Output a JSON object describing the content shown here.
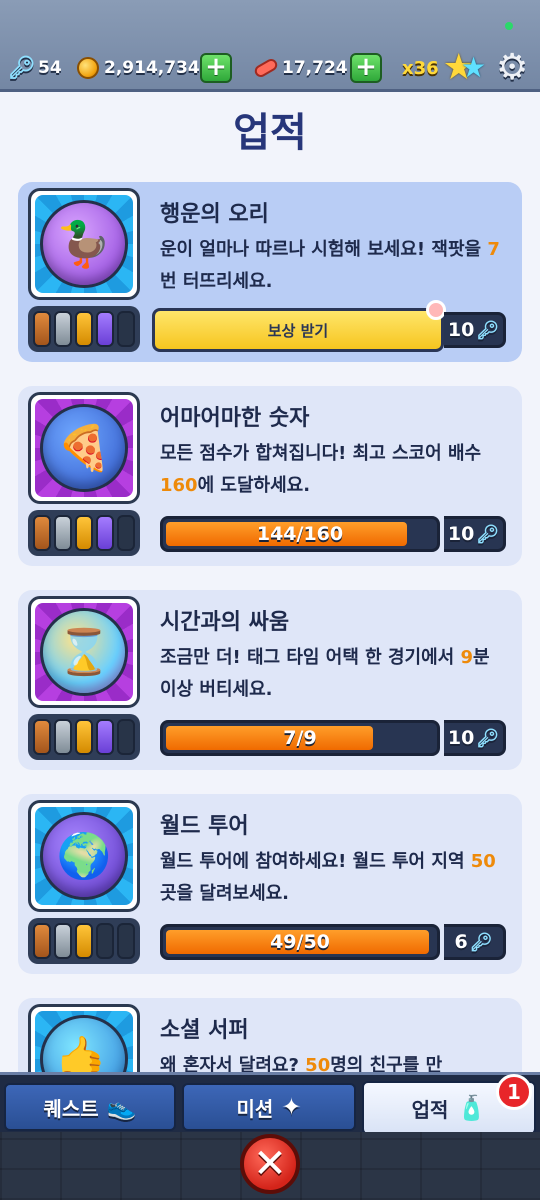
{
  "topbar": {
    "keys": "54",
    "coins": "2,914,734",
    "boards": "17,724",
    "multiplier": "x36"
  },
  "page": {
    "title": "업적"
  },
  "achievements": [
    {
      "title": "행운의 오리",
      "desc_pre": "운이 얼마나 따르나 시험해 보세요! 잭팟을 ",
      "desc_hl": "7",
      "desc_post": "번 터뜨리세요.",
      "claim_label": "보상 받기",
      "reward": "10",
      "icon": "duck-icon"
    },
    {
      "title": "어마어마한 숫자",
      "desc_pre": "모든 점수가 합쳐집니다! 최고 스코어 배수 ",
      "desc_hl": "160",
      "desc_post": "에 도달하세요.",
      "progress_text": "144/160",
      "progress": 0.9,
      "reward": "10",
      "icon": "pizza-icon"
    },
    {
      "title": "시간과의 싸움",
      "desc_pre": "조금만 더! 태그 타임 어택 한 경기에서 ",
      "desc_hl": "9",
      "desc_post": "분 이상 버티세요.",
      "progress_text": "7/9",
      "progress": 0.778,
      "reward": "10",
      "icon": "hourglass-icon"
    },
    {
      "title": "월드 투어",
      "desc_pre": "월드 투어에 참여하세요! 월드 투어 지역 ",
      "desc_hl": "50",
      "desc_post": "곳을 달려보세요.",
      "progress_text": "49/50",
      "progress": 0.98,
      "reward": "6",
      "icon": "globe-apple-icon"
    },
    {
      "title": "소셜 서퍼",
      "desc_pre": "왜 혼자서 달려요? ",
      "desc_hl": "50",
      "desc_post": "명의 친구를 만",
      "icon": "shaka-hand-icon"
    }
  ],
  "tabs": {
    "quest": "퀘스트",
    "mission": "미션",
    "achievement": "업적",
    "badge_count": "1"
  },
  "colors": {
    "title_navy": "#27367a",
    "highlight_orange": "#ee8a0a",
    "progress_orange": "#f06a00"
  }
}
